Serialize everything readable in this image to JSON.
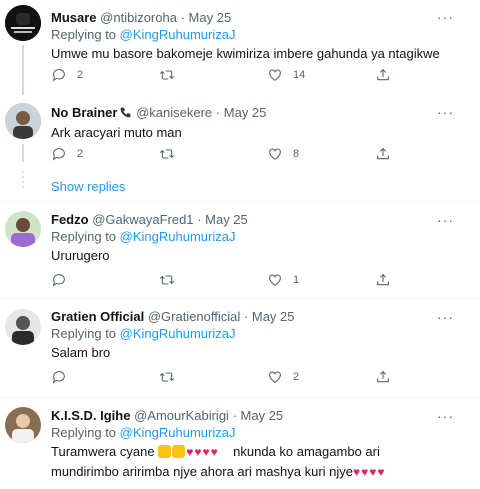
{
  "tweets": [
    {
      "name": "Musare",
      "handle": "@ntibizoroha",
      "separator": "·",
      "date": "May 25",
      "replying_prefix": "Replying to ",
      "replying_to": "@KingRuhumurizaJ",
      "text": "Umwe mu basore bakomeje kwimiriza imbere gahunda ya ntagikwe",
      "counts": {
        "reply": "2",
        "retweet": "",
        "like": "14"
      }
    },
    {
      "name": "No Brainer",
      "handle": "@kanisekere",
      "separator": "·",
      "date": "May 25",
      "text": "Ark aracyari muto man",
      "counts": {
        "reply": "2",
        "retweet": "",
        "like": "8"
      }
    },
    {
      "name": "Fedzo",
      "handle": "@GakwayaFred1",
      "separator": "·",
      "date": "May 25",
      "replying_prefix": "Replying to ",
      "replying_to": "@KingRuhumurizaJ",
      "text": "Ururugero",
      "counts": {
        "reply": "",
        "retweet": "",
        "like": "1"
      }
    },
    {
      "name": "Gratien Official",
      "handle": "@Gratienofficial",
      "separator": "·",
      "date": "May 25",
      "replying_prefix": "Replying to ",
      "replying_to": "@KingRuhumurizaJ",
      "text": "Salam bro",
      "counts": {
        "reply": "",
        "retweet": "",
        "like": "2"
      }
    },
    {
      "name": "K.I.S.D. Igihe",
      "handle": "@AmourKabirigi",
      "separator": "·",
      "date": "May 25",
      "replying_prefix": "Replying to ",
      "replying_to": "@KingRuhumurizaJ",
      "text_part1": "Turamwera cyane",
      "text_part2": "nkunda ko amagambo ari",
      "text_line2": "mundirimbo aririmba njye ahora ari mashya kuri njye"
    }
  ],
  "show_replies_label": "Show replies",
  "more_glyph": "···",
  "avatar_badge_text": "IT'S NOT OVER\nUNTIL I WIN",
  "icons": [
    "reply-icon",
    "retweet-icon",
    "like-icon",
    "share-icon",
    "more-icon",
    "phone-icon",
    "clap-emoji",
    "heart-emoji"
  ],
  "colors": {
    "accent": "#1d9bf0",
    "muted": "#536471",
    "heart": "#e0245e",
    "clap": "#f5c518"
  }
}
